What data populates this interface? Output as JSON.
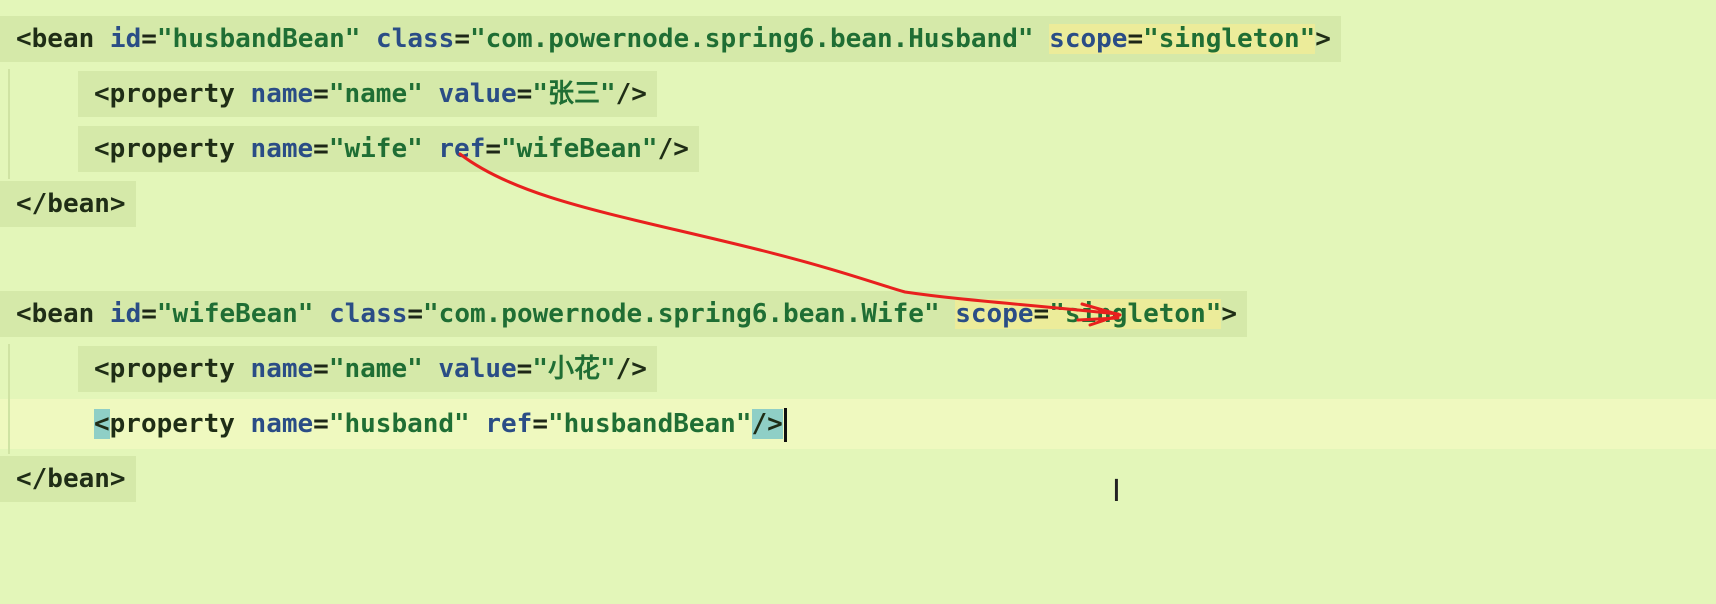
{
  "editor": {
    "lines": [
      {
        "open": "<",
        "tag": "bean",
        "a1": " id",
        "eq1": "=",
        "v1": "\"husbandBean\"",
        "a2": " class",
        "eq2": "=",
        "v2": "\"com.powernode.spring6.bean.Husband\"",
        "a3": "scope",
        "eq3": "=",
        "v3": "\"singleton\"",
        "close": ">"
      },
      {
        "open": "<",
        "tag": "property",
        "a1": " name",
        "eq1": "=",
        "v1": "\"name\"",
        "a2": " value",
        "eq2": "=",
        "v2": "\"张三\"",
        "close": "/>"
      },
      {
        "open": "<",
        "tag": "property",
        "a1": " name",
        "eq1": "=",
        "v1": "\"wife\"",
        "a2": " ref",
        "eq2": "=",
        "v2": "\"wifeBean\"",
        "close": "/>"
      },
      {
        "text": "</bean>"
      },
      {
        "open": "<",
        "tag": "bean",
        "a1": " id",
        "eq1": "=",
        "v1": "\"wifeBean\"",
        "a2": " class",
        "eq2": "=",
        "v2": "\"com.powernode.spring6.bean.Wife\"",
        "a3": "scope",
        "eq3": "=",
        "v3": "\"singleton\"",
        "close": ">"
      },
      {
        "open": "<",
        "tag": "property",
        "a1": " name",
        "eq1": "=",
        "v1": "\"name\"",
        "a2": " value",
        "eq2": "=",
        "v2": "\"小花\"",
        "close": "/>"
      },
      {
        "open": "<",
        "tag": "property",
        "a1": " name",
        "eq1": "=",
        "v1": "\"husband\"",
        "a2": " ref",
        "eq2": "=",
        "v2": "\"husbandBean\"",
        "close": "/>"
      },
      {
        "text": "</bean>"
      }
    ]
  },
  "colors": {
    "background": "#e3f6b9",
    "annotation_arrow": "#e8201e"
  },
  "icons": {
    "text_cursor": "i-beam-cursor-icon"
  }
}
